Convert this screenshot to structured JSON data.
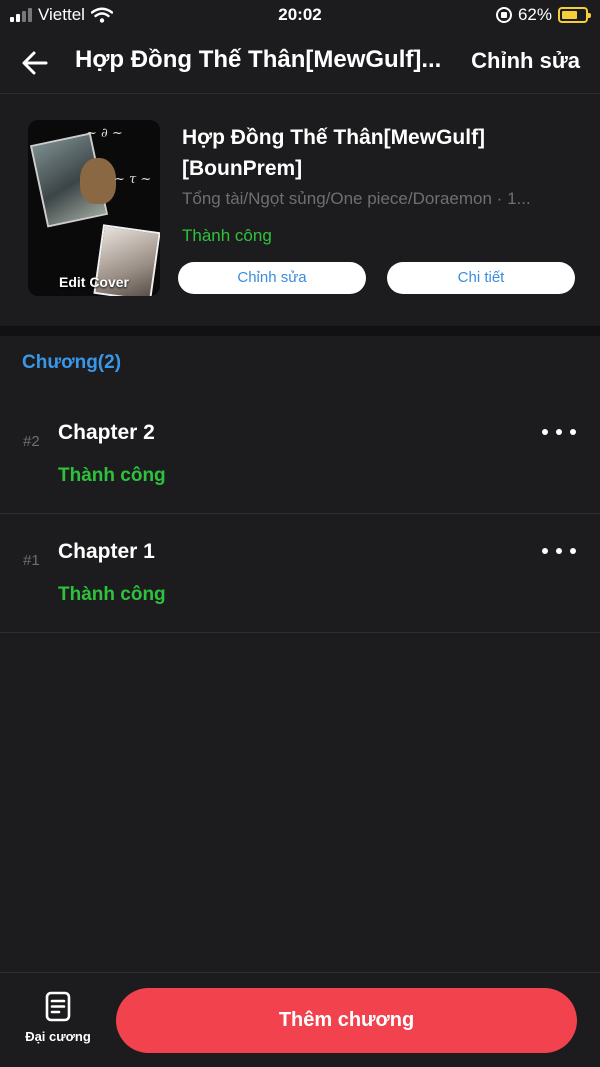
{
  "status_bar": {
    "carrier": "Viettel",
    "time": "20:02",
    "battery": "62%"
  },
  "nav": {
    "title": "Hợp Đồng Thế Thân[MewGulf]...",
    "edit_label": "Chỉnh sửa"
  },
  "story": {
    "title": "Hợp Đồng Thế Thân[MewGulf][BounPrem]",
    "tags": "Tổng tài/Ngọt sủng/One piece/Doraemon · 1...",
    "status": "Thành công",
    "edit_cover_label": "Edit Cover",
    "edit_button": "Chỉnh sửa",
    "detail_button": "Chi tiết",
    "status_color": "#2ec23c"
  },
  "chapters": {
    "heading": "Chương(2)",
    "items": [
      {
        "number": "#2",
        "title": "Chapter 2",
        "status": "Thành công"
      },
      {
        "number": "#1",
        "title": "Chapter 1",
        "status": "Thành công"
      }
    ]
  },
  "bottom": {
    "outline_label": "Đại cương",
    "add_chapter_label": "Thêm chương",
    "accent_color": "#f1424e"
  },
  "icons": [
    "signal-icon",
    "wifi-icon",
    "rotation-lock-icon",
    "battery-icon",
    "back-arrow-icon",
    "more-icon",
    "outline-document-icon"
  ]
}
